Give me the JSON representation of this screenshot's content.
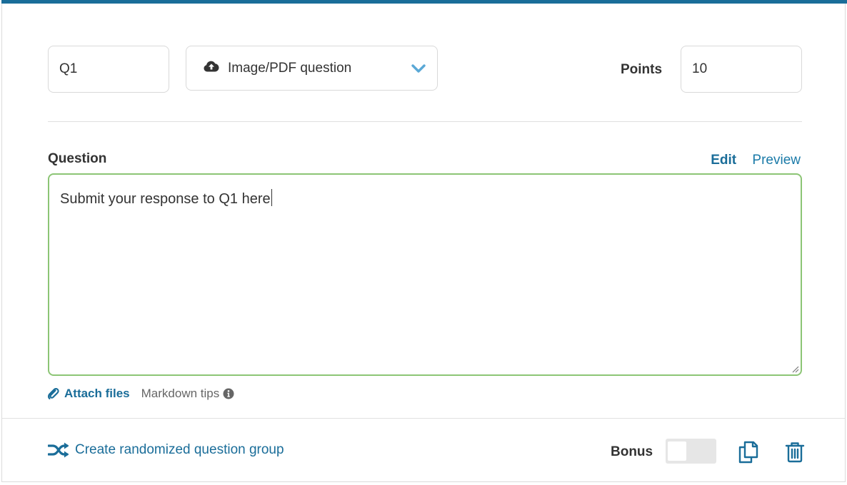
{
  "question": {
    "name": "Q1",
    "type_label": "Image/PDF question",
    "points_label": "Points",
    "points_value": "10",
    "heading": "Question",
    "tabs": {
      "edit": "Edit",
      "preview": "Preview"
    },
    "body_text": "Submit your response to Q1 here"
  },
  "editor_links": {
    "attach_files": "Attach files",
    "markdown_tips": "Markdown tips"
  },
  "footer": {
    "randomize_label": "Create randomized question group",
    "bonus_label": "Bonus",
    "bonus_enabled": false
  },
  "icons": {
    "type": "cloud-upload-icon",
    "dropdown": "chevron-down-icon",
    "attach": "paperclip-icon",
    "info": "info-circle-icon",
    "randomize": "shuffle-icon",
    "duplicate": "duplicate-icon",
    "delete": "trash-icon"
  },
  "colors": {
    "accent": "#1a6d99",
    "top_bar": "#1a6d99",
    "editor_border": "#8cc575",
    "chevron": "#5aa8d6"
  }
}
